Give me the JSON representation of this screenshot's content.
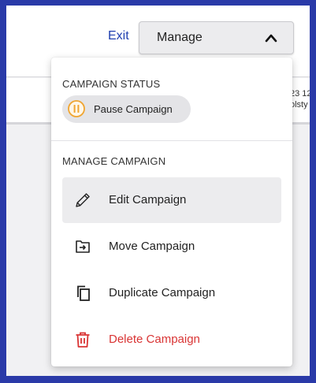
{
  "header": {
    "exit_label": "Exit",
    "manage_label": "Manage"
  },
  "background": {
    "peek_line1": "23 12",
    "peek_line2": "olsty"
  },
  "dropdown": {
    "status_title": "CAMPAIGN STATUS",
    "pause_label": "Pause Campaign",
    "manage_title": "MANAGE CAMPAIGN",
    "items": [
      {
        "label": "Edit Campaign",
        "icon": "pencil-icon"
      },
      {
        "label": "Move Campaign",
        "icon": "move-folder-icon"
      },
      {
        "label": "Duplicate Campaign",
        "icon": "duplicate-icon"
      },
      {
        "label": "Delete Campaign",
        "icon": "trash-icon"
      }
    ]
  },
  "colors": {
    "frame_border": "#2a3aa8",
    "link": "#1f3fb0",
    "pause_accent": "#f0a531",
    "danger": "#d93434"
  }
}
